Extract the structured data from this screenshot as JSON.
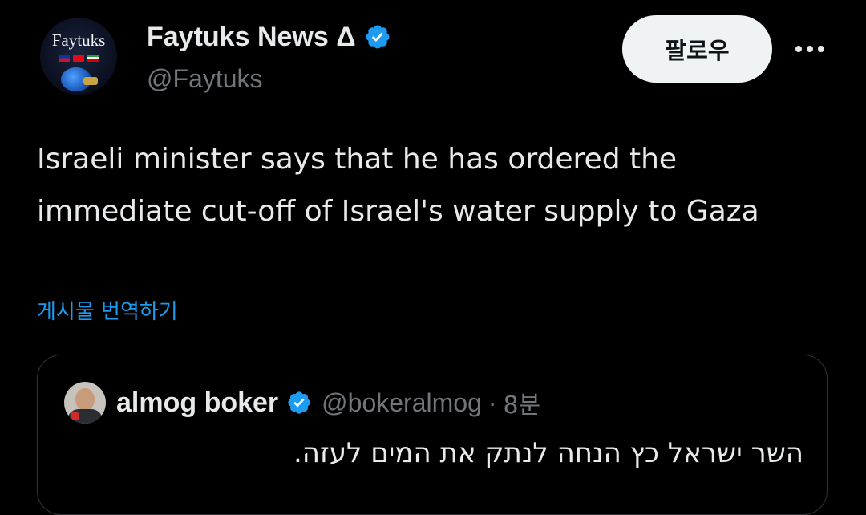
{
  "author": {
    "avatar_text": "Faytuks",
    "display_name": "Faytuks News Δ",
    "handle": "@Faytuks",
    "verified": true
  },
  "actions": {
    "follow_label": "팔로우",
    "more_label": "···"
  },
  "tweet": {
    "text": "Israeli minister says that he has ordered the immediate cut-off of Israel's water supply to Gaza",
    "translate_label": "게시물 번역하기"
  },
  "quote": {
    "display_name": "almog boker",
    "handle": "@bokeralmog",
    "separator": "·",
    "time": "8분",
    "text": "השר ישראל כץ הנחה לנתק את המים לעזה.",
    "verified": true
  },
  "colors": {
    "background": "#000000",
    "text_primary": "#e7e9ea",
    "text_secondary": "#71767b",
    "accent": "#1d9bf0",
    "follow_button_bg": "#eff3f4",
    "border": "#2f3336"
  },
  "icons": {
    "verified": "verified-badge-icon",
    "more": "more-horizontal-icon"
  }
}
